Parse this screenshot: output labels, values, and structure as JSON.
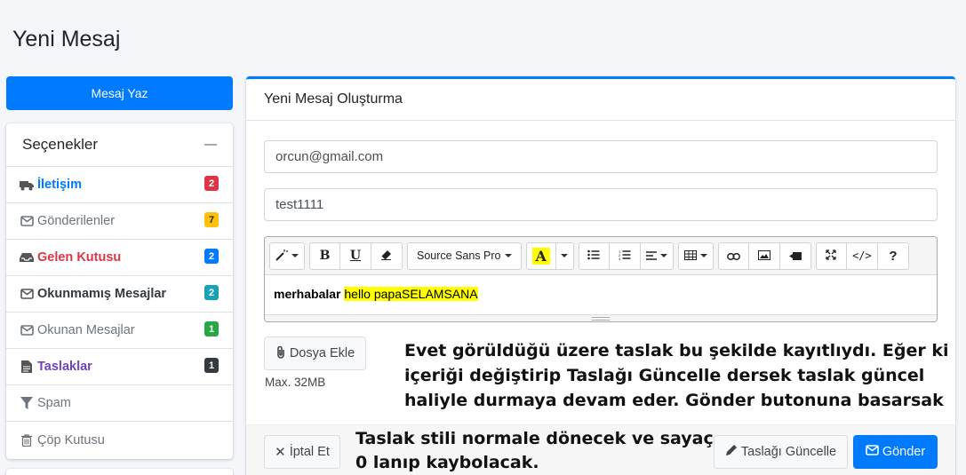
{
  "page": {
    "title": "Yeni Mesaj"
  },
  "sidebar": {
    "compose_label": "Mesaj Yaz",
    "options_title": "Seçenekler",
    "items": [
      {
        "label": "İletişim",
        "icon": "truck-icon",
        "badge": "2",
        "badge_color": "#dc3545",
        "color": "#007bff"
      },
      {
        "label": "Gönderilenler",
        "icon": "envelope-icon",
        "badge": "7",
        "badge_color": "#ffc107",
        "color": "#6c757d"
      },
      {
        "label": "Gelen Kutusu",
        "icon": "inbox-icon",
        "badge": "2",
        "badge_color": "#007bff",
        "color": "#dc3545"
      },
      {
        "label": "Okunmamış Mesajlar",
        "icon": "envelope-icon",
        "badge": "2",
        "badge_color": "#17a2b8",
        "color": "#343a40"
      },
      {
        "label": "Okunan Mesajlar",
        "icon": "envelope-open-icon",
        "badge": "1",
        "badge_color": "#28a745",
        "color": "#6c757d"
      },
      {
        "label": "Taslaklar",
        "icon": "file-icon",
        "badge": "1",
        "badge_color": "#343a40",
        "color": "#6f42c1"
      },
      {
        "label": "Spam",
        "icon": "filter-icon",
        "badge": "",
        "badge_color": "",
        "color": "#6c757d"
      },
      {
        "label": "Çöp Kutusu",
        "icon": "trash-icon",
        "badge": "",
        "badge_color": "",
        "color": "#6c757d"
      }
    ]
  },
  "compose": {
    "header": "Yeni Mesaj Oluşturma",
    "to_value": "orcun@gmail.com",
    "subject_value": "test1111",
    "editor": {
      "font_name": "Source Sans Pro",
      "content_bold": "merhabalar",
      "content_highlight": "hello papaSELAMSANA"
    },
    "attach_label": "Dosya Ekle",
    "max_size": "Max. 32MB",
    "cancel_label": "İptal Et",
    "update_draft_label": "Taslağı Güncelle",
    "send_label": "Gönder"
  },
  "annotations": {
    "main": [
      "Evet görüldüğü üzere taslak bu şekilde kayıtlıydı. Eğer ki",
      "içeriği değiştirip Taslağı Güncelle dersek taslak güncel",
      "haliyle durmaya devam eder. Gönder butonuna basarsak"
    ],
    "footer": [
      "Taslak stili normale dönecek ve sayaç",
      "0 lanıp kaybolacak."
    ]
  },
  "colors": {
    "accent": "#007bff",
    "highlight": "#ffff00"
  }
}
